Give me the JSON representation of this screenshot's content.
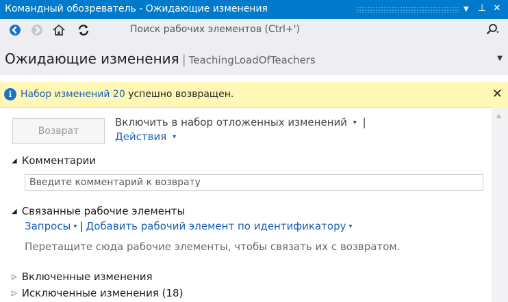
{
  "window": {
    "title": "Командный обозреватель - Ожидающие изменения",
    "controls": {
      "dropdown": "▼",
      "pin": "⊥",
      "close": "✕"
    }
  },
  "toolbar": {
    "back_icon": "back-arrow-icon",
    "forward_icon": "forward-arrow-icon",
    "home_icon": "home-icon",
    "refresh_icon": "refresh-icon",
    "search_placeholder": "Поиск рабочих элементов (Ctrl+')",
    "search_icon": "⌕",
    "search_caret": "▾"
  },
  "header": {
    "title": "Ожидающие изменения",
    "separator": "|",
    "project": "TeachingLoadOfTeachers",
    "caret": "▼"
  },
  "notice": {
    "info_glyph": "i",
    "link": "Набор изменений 20",
    "message": " успешно возвращен.",
    "close": "✕"
  },
  "actions": {
    "checkin_label": "Возврат",
    "shelve_label": "Включить в набор отложенных изменений",
    "actions_label": "Действия",
    "caret": "▾",
    "bar": "|"
  },
  "sections": {
    "tri_open": "◢",
    "tri_closed": "▷",
    "comments": {
      "label": "Комментарии",
      "placeholder": "Введите комментарий к возврату"
    },
    "related": {
      "label": "Связанные рабочие элементы",
      "queries": "Запросы",
      "add_by_id": "Добавить рабочий элемент по идентификатору",
      "hint": "Перетащите сюда рабочие элементы, чтобы связать их с возвратом."
    },
    "included": {
      "label": "Включенные изменения"
    },
    "excluded": {
      "label": "Исключенные изменения (18)"
    }
  },
  "colors": {
    "accent": "#007acc",
    "link": "#1a5fb4",
    "notice_bg": "#fff7b6",
    "panel_bg": "#eeeef2"
  }
}
